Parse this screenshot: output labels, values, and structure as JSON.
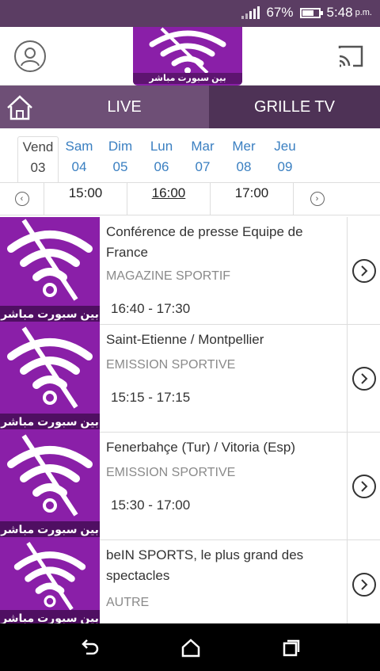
{
  "status_bar": {
    "battery_percent": "67%",
    "time": "5:48",
    "ampm": "p.m."
  },
  "header": {
    "logo_text": "بين سبورت مباشر",
    "profile_icon": "user-circle-icon",
    "cast_icon": "cast-icon"
  },
  "tabs": {
    "home_icon": "home-icon",
    "live_label": "LIVE",
    "grille_label": "GRILLE TV"
  },
  "days": [
    {
      "name": "Vend",
      "num": "03"
    },
    {
      "name": "Sam",
      "num": "04"
    },
    {
      "name": "Dim",
      "num": "05"
    },
    {
      "name": "Lun",
      "num": "06"
    },
    {
      "name": "Mar",
      "num": "07"
    },
    {
      "name": "Mer",
      "num": "08"
    },
    {
      "name": "Jeu",
      "num": "09"
    }
  ],
  "times": [
    "15:00",
    "16:00",
    "17:00"
  ],
  "programs": [
    {
      "title": "Conférence de presse Equipe de France",
      "category": "MAGAZINE SPORTIF",
      "time": "16:40 - 17:30",
      "thumb_caption": "بين سبورت مباشر"
    },
    {
      "title": "Saint-Etienne / Montpellier",
      "category": "EMISSION SPORTIVE",
      "time": "15:15 - 17:15",
      "thumb_caption": "بين سبورت مباشر"
    },
    {
      "title": "Fenerbahçe (Tur) / Vitoria (Esp)",
      "category": "EMISSION SPORTIVE",
      "time": "15:30 - 17:00",
      "thumb_caption": "بين سبورت مباشر"
    },
    {
      "title": "beIN SPORTS, le plus grand des spectacles",
      "category": "AUTRE",
      "time": "",
      "thumb_caption": "بين سبورت مباشر"
    }
  ],
  "colors": {
    "brand_purple": "#8a1fa8",
    "tab_active": "#6e4f76",
    "tab_inactive": "#4e3256",
    "day_link": "#3a7fc1"
  }
}
